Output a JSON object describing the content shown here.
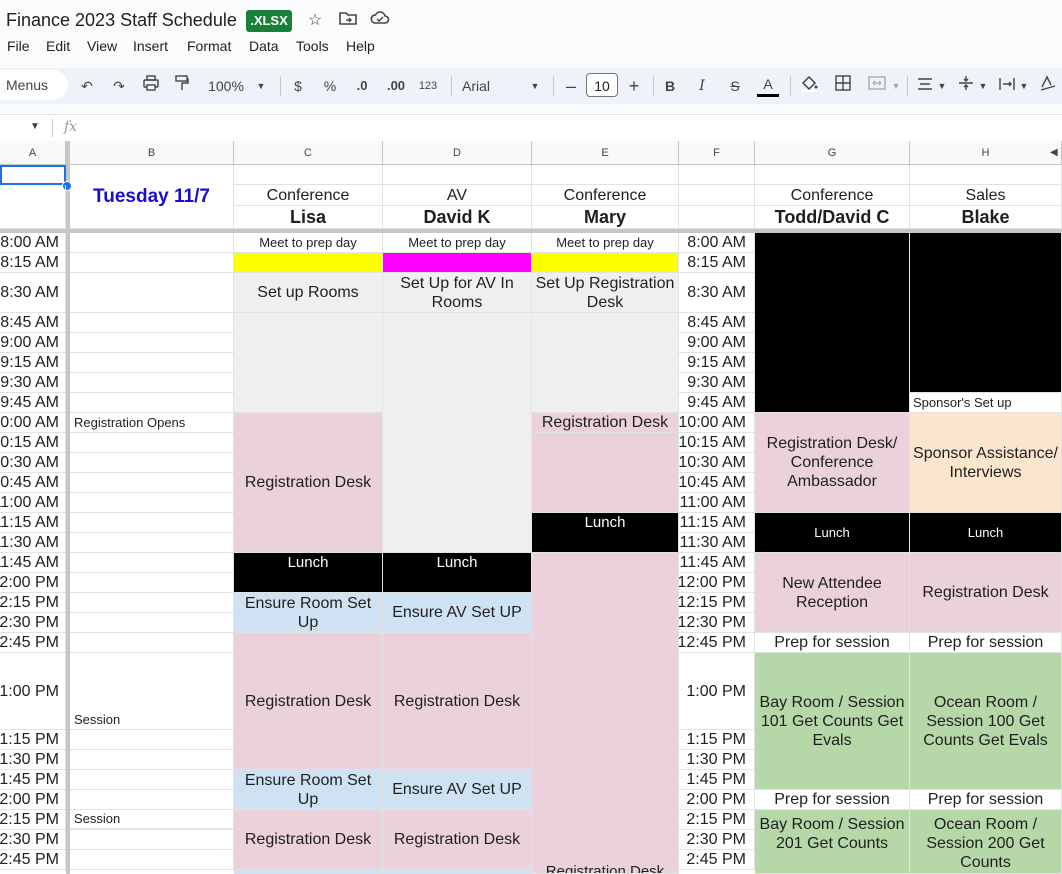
{
  "doc": {
    "title": "Finance 2023 Staff Schedule",
    "badge": ".XLSX"
  },
  "menu": [
    "File",
    "Edit",
    "View",
    "Insert",
    "Format",
    "Data",
    "Tools",
    "Help"
  ],
  "toolbar": {
    "menus_label": "Menus",
    "zoom": "100%",
    "currency": "$",
    "percent": "%",
    "dec_dec": ".0",
    "dec_inc": ".00",
    "number_format": "123",
    "font": "Arial",
    "font_size": "10",
    "bold": "B",
    "italic": "I",
    "text_color": "A"
  },
  "formula_bar": {
    "fx": "fx"
  },
  "columns": [
    "A",
    "B",
    "C",
    "D",
    "E",
    "F",
    "G",
    "H"
  ],
  "sheet": {
    "date_label": "Tuesday 11/7",
    "roles": {
      "c": "Conference",
      "d": "AV",
      "e": "Conference",
      "g": "Conference",
      "h": "Sales"
    },
    "names": {
      "c": "Lisa",
      "d": "David K",
      "e": "Mary",
      "g": "Todd/David C",
      "h": "Blake"
    },
    "times": [
      "8:00 AM",
      "8:15 AM",
      "8:30 AM",
      "8:45 AM",
      "9:00 AM",
      "9:15 AM",
      "9:30 AM",
      "9:45 AM",
      "10:00 AM",
      "10:15 AM",
      "10:30 AM",
      "10:45 AM",
      "11:00 AM",
      "11:15 AM",
      "11:30 AM",
      "11:45 AM",
      "12:00 PM",
      "12:15 PM",
      "12:30 PM",
      "12:45 PM",
      "1:00 PM",
      "1:15 PM",
      "1:30 PM",
      "1:45 PM",
      "2:00 PM",
      "2:15 PM",
      "2:30 PM",
      "2:45 PM"
    ],
    "notes_b": {
      "registration_opens": "Registration Opens",
      "session_1": "Session",
      "session_2": "Session"
    },
    "blocks": {
      "meet_prep": "Meet to prep day",
      "set_up_rooms": "Set up Rooms",
      "set_up_av": "Set Up for  AV In Rooms",
      "set_up_reg_desk": "Set Up Registration Desk",
      "registration_desk": "Registration Desk",
      "lunch": "Lunch",
      "ensure_room": "Ensure Room Set Up",
      "ensure_av": "Ensure AV Set UP",
      "sponsor_setup": "Sponsor's Set up",
      "reg_desk_ambassador": "Registration Desk/ Conference Ambassador",
      "sponsor_assist": "Sponsor Assistance/ Interviews",
      "new_attendee": "New Attendee Reception",
      "prep_session": "Prep for session",
      "bay_101": "Bay Room / Session 101 Get Counts Get Evals",
      "ocean_100": "Ocean  Room / Session 100 Get Counts Get Evals",
      "bay_201": "Bay Room / Session 201 Get Counts",
      "ocean_200": "Ocean  Room / Session 200 Get Counts"
    }
  }
}
